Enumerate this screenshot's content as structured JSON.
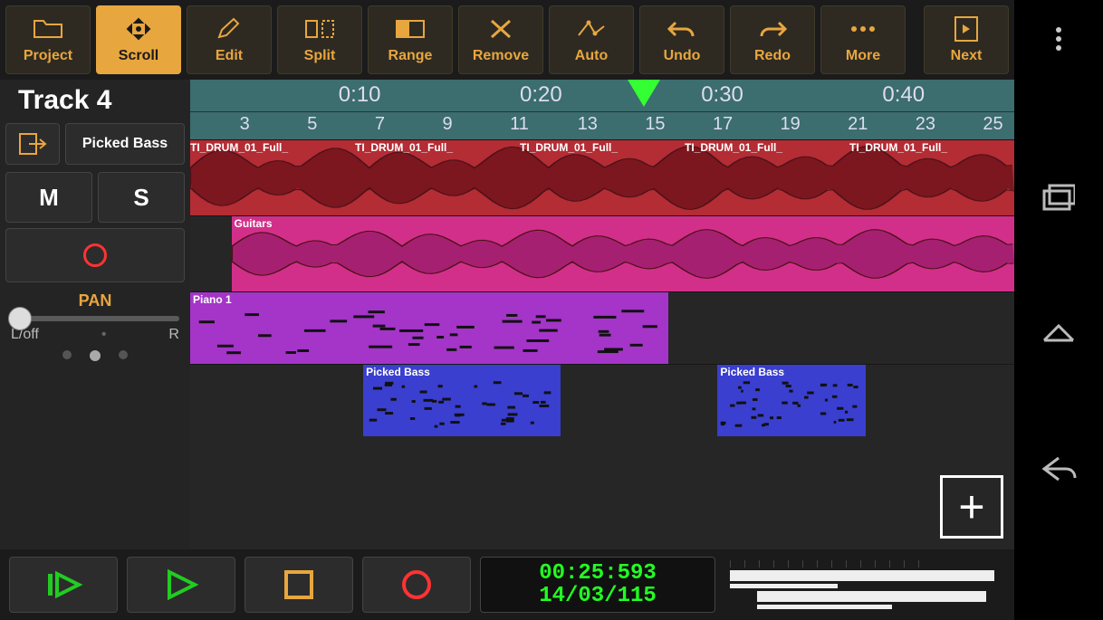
{
  "toolbar": {
    "items": [
      {
        "id": "project",
        "label": "Project",
        "active": false
      },
      {
        "id": "scroll",
        "label": "Scroll",
        "active": true
      },
      {
        "id": "edit",
        "label": "Edit",
        "active": false
      },
      {
        "id": "split",
        "label": "Split",
        "active": false
      },
      {
        "id": "range",
        "label": "Range",
        "active": false
      },
      {
        "id": "remove",
        "label": "Remove",
        "active": false
      },
      {
        "id": "auto",
        "label": "Auto",
        "active": false
      },
      {
        "id": "undo",
        "label": "Undo",
        "active": false
      },
      {
        "id": "redo",
        "label": "Redo",
        "active": false
      },
      {
        "id": "more",
        "label": "More",
        "active": false
      }
    ],
    "next_label": "Next"
  },
  "side": {
    "title": "Track 4",
    "selected_track_name": "Picked Bass",
    "mute_label": "M",
    "solo_label": "S",
    "pan_label": "PAN",
    "pan_left": "L/off",
    "pan_right": "R"
  },
  "transport": {
    "timecode": "00:25:593",
    "position": "14/03/115"
  },
  "ruler": {
    "time_ticks": [
      "0:10",
      "0:20",
      "0:30",
      "0:40"
    ],
    "bar_ticks": [
      "3",
      "5",
      "7",
      "9",
      "11",
      "13",
      "15",
      "17",
      "19",
      "21",
      "23",
      "25"
    ]
  },
  "tracks": [
    {
      "name": "TI_DRUM_01_Full_",
      "color": "#b42c34",
      "clips": [
        {
          "start": 0,
          "end": 100,
          "label": "TI_DRUM_01_Full_",
          "repeat_label": 5
        }
      ]
    },
    {
      "name": "Guitars",
      "color": "#d22f8a",
      "clips": [
        {
          "start": 5,
          "end": 100,
          "label": "Guitars"
        }
      ]
    },
    {
      "name": "Piano 1",
      "color": "#a435c8",
      "clips": [
        {
          "start": 0,
          "end": 58,
          "label": "Piano 1"
        }
      ]
    },
    {
      "name": "Picked Bass",
      "color": "#3a3fcf",
      "clips": [
        {
          "start": 21,
          "end": 45,
          "label": "Picked Bass"
        },
        {
          "start": 64,
          "end": 82,
          "label": "Picked Bass"
        }
      ]
    }
  ],
  "playhead_pct": 55
}
